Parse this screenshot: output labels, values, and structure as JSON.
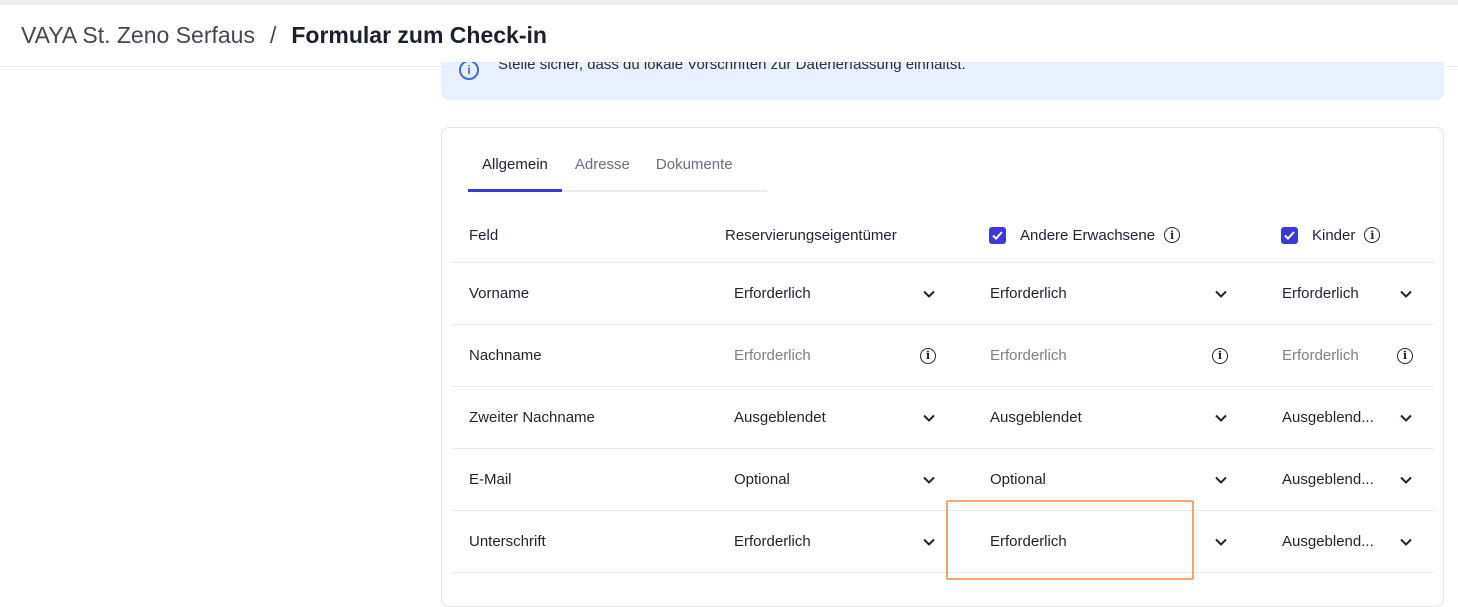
{
  "header": {
    "property_name": "VAYA St. Zeno Serfaus",
    "separator": "/",
    "page_title": "Formular zum Check-in"
  },
  "info_banner": {
    "icon": "info-icon",
    "text": "Stelle sicher, dass du lokale Vorschriften zur Datenerfassung einhältst."
  },
  "tabs": [
    {
      "label": "Allgemein",
      "active": true
    },
    {
      "label": "Adresse",
      "active": false
    },
    {
      "label": "Dokumente",
      "active": false
    }
  ],
  "table": {
    "headers": {
      "field": "Feld",
      "owner": "Reservierungseigentümer",
      "adults": "Andere Erwachsene",
      "adults_checked": true,
      "kids": "Kinder",
      "kids_checked": true
    },
    "rows": [
      {
        "field": "Vorname",
        "owner": "Erforderlich",
        "adults": "Erforderlich",
        "kids": "Erforderlich",
        "locked": false
      },
      {
        "field": "Nachname",
        "owner": "Erforderlich",
        "adults": "Erforderlich",
        "kids": "Erforderlich",
        "locked": true
      },
      {
        "field": "Zweiter Nachname",
        "owner": "Ausgeblendet",
        "adults": "Ausgeblendet",
        "kids": "Ausgeblend...",
        "locked": false
      },
      {
        "field": "E-Mail",
        "owner": "Optional",
        "adults": "Optional",
        "kids": "Ausgeblend...",
        "locked": false
      },
      {
        "field": "Unterschrift",
        "owner": "Erforderlich",
        "adults": "Erforderlich",
        "kids": "Ausgeblend...",
        "locked": false
      }
    ]
  },
  "colors": {
    "accent": "#3b3ad6",
    "banner_bg": "#e8f0fd",
    "highlight": "#f4a471"
  }
}
